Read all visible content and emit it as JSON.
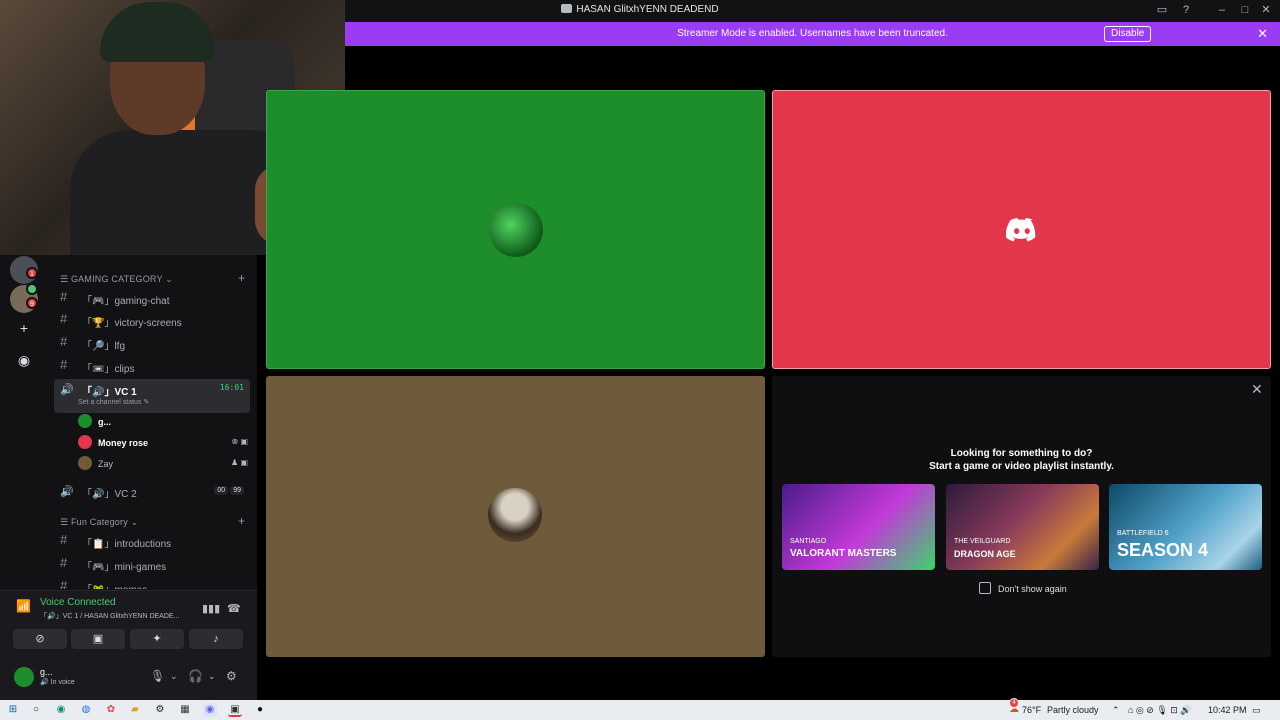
{
  "window": {
    "title": "HASAN GlitxhYENN DEADEND"
  },
  "banner": {
    "text": "Streamer Mode is enabled. Usernames have been truncated.",
    "button": "Disable"
  },
  "servers": {
    "badges": [
      "1",
      "9"
    ]
  },
  "sidebar": {
    "categories": [
      {
        "label": "GAMING CATEGORY"
      },
      {
        "label": "Fun Category"
      }
    ],
    "channels": [
      {
        "label": "「🎮」gaming-chat"
      },
      {
        "label": "「🏆」victory-screens"
      },
      {
        "label": "「🔎」lfg"
      },
      {
        "label": "「📼」clips"
      }
    ],
    "vc1": {
      "label": "「🔊」VC 1",
      "timer": "16:01",
      "status": "Set a channel status ✎"
    },
    "members": [
      {
        "name": "g...",
        "color": "#1e8e2d"
      },
      {
        "name": "Money rose",
        "color": "#e2374b"
      },
      {
        "name": "Zay",
        "color": "#6f5b3c"
      }
    ],
    "vc2": {
      "label": "「🔊」VC 2",
      "count_a": "00",
      "count_b": "99"
    },
    "fun_channels": [
      {
        "label": "「📋」introductions"
      },
      {
        "label": "「🎮」mini-games"
      },
      {
        "label": "「🐸」memes"
      }
    ]
  },
  "voice": {
    "connected": "Voice Connected",
    "channel": "「🔊」VC 1 / HASAN GlitxhYENN DEADE...",
    "user_name": "g...",
    "user_status": "🔊 In voice"
  },
  "activity": {
    "line1": "Looking for something to do?",
    "line2": "Start a game or video playlist instantly.",
    "cards": [
      {
        "label": "VALORANT MASTERS",
        "sub": "SANTIAGO"
      },
      {
        "label": "DRAGON AGE",
        "sub": "THE VEILGUARD"
      },
      {
        "label": "SEASON 4",
        "sub": "BATTLEFIELD 6"
      }
    ],
    "dont_show": "Don't show again"
  },
  "taskbar": {
    "weather": "76°F",
    "condition": "Partly cloudy",
    "time": "10:42 PM",
    "weather_badge": "4"
  },
  "colors": {
    "accent": "#9b3cf5",
    "green": "#1e8e2d",
    "red": "#e2374b",
    "olive": "#6f5b3c",
    "online": "#4ec871"
  }
}
